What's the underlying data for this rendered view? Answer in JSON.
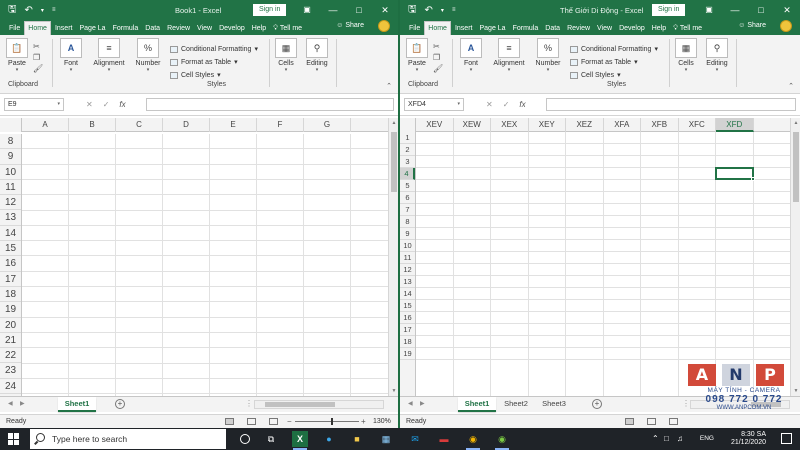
{
  "left_window": {
    "title": "Book1  -  Excel",
    "signin": "Sign in",
    "tabs": [
      "File",
      "Home",
      "Insert",
      "Page La",
      "Formula",
      "Data",
      "Review",
      "View",
      "Develop",
      "Help"
    ],
    "active_tab": "Home",
    "tell_me": "Tell me",
    "share": "Share",
    "ribbon": {
      "paste": "Paste",
      "clipboard": "Clipboard",
      "font": "Font",
      "alignment": "Alignment",
      "number": "Number",
      "conditional_formatting": "Conditional Formatting",
      "format_as_table": "Format as Table",
      "cell_styles": "Cell Styles",
      "styles": "Styles",
      "cells": "Cells",
      "editing": "Editing"
    },
    "name_box": "E9",
    "columns": [
      "A",
      "B",
      "C",
      "D",
      "E",
      "F",
      "G"
    ],
    "rows": [
      "8",
      "9",
      "10",
      "11",
      "12",
      "13",
      "14",
      "15",
      "16",
      "17",
      "18",
      "19",
      "20",
      "21",
      "22",
      "23",
      "24"
    ],
    "sheets": [
      "Sheet1"
    ],
    "active_sheet": "Sheet1",
    "status": "Ready",
    "zoom": "130%"
  },
  "right_window": {
    "title": "Thế Giới Di Động  -  Excel",
    "signin": "Sign in",
    "tabs": [
      "File",
      "Home",
      "Insert",
      "Page La",
      "Formula",
      "Data",
      "Review",
      "View",
      "Develop",
      "Help"
    ],
    "active_tab": "Home",
    "tell_me": "Tell me",
    "share": "Share",
    "ribbon": {
      "paste": "Paste",
      "clipboard": "Clipboard",
      "font": "Font",
      "alignment": "Alignment",
      "number": "Number",
      "conditional_formatting": "Conditional Formatting",
      "format_as_table": "Format as Table",
      "cell_styles": "Cell Styles",
      "styles": "Styles",
      "cells": "Cells",
      "editing": "Editing"
    },
    "name_box": "XFD4",
    "columns": [
      "XEV",
      "XEW",
      "XEX",
      "XEY",
      "XEZ",
      "XFA",
      "XFB",
      "XFC",
      "XFD"
    ],
    "rows": [
      "1",
      "2",
      "3",
      "4",
      "5",
      "6",
      "7",
      "8",
      "9",
      "10",
      "11",
      "12",
      "13",
      "14",
      "15",
      "16",
      "17",
      "18",
      "19"
    ],
    "sheets": [
      "Sheet1",
      "Sheet2",
      "Sheet3"
    ],
    "active_sheet": "Sheet1",
    "status": "Ready"
  },
  "taskbar": {
    "search_placeholder": "Type here to search",
    "language": "ENG",
    "time": "8:30 SA",
    "date": "21/12/2020"
  },
  "watermark": {
    "letters": [
      "A",
      "N",
      "P"
    ],
    "tagline": "MÁY TÍNH - CAMERA",
    "phone": "098 772 0 772",
    "url": "WWW.ANPCOM.VN"
  },
  "colors": {
    "excel_green": "#217346",
    "taskbar": "#1f2328",
    "watermark_red": "#d24a3a",
    "watermark_blue": "#2a4a8c"
  }
}
